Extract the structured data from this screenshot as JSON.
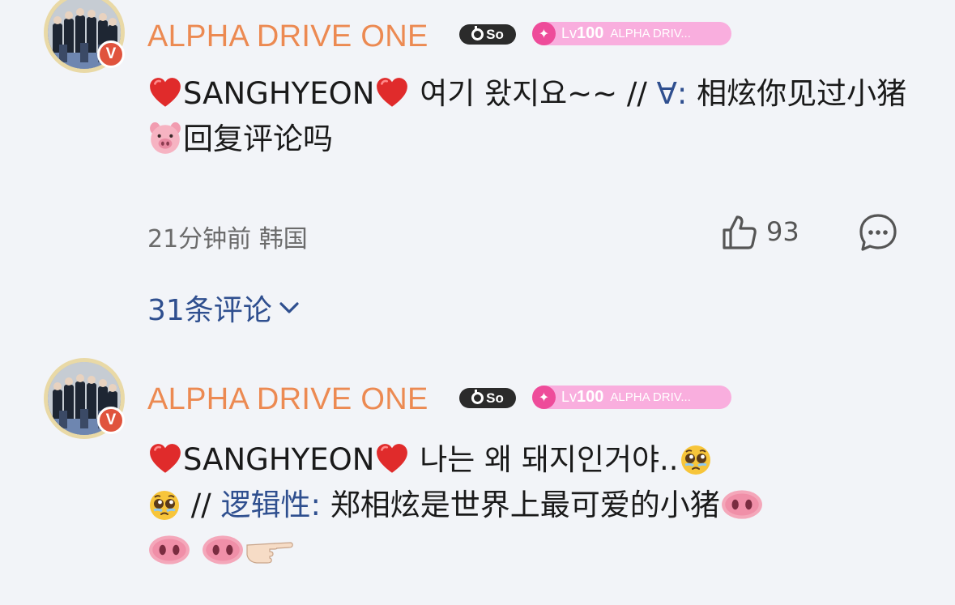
{
  "comments": [
    {
      "username": "ALPHA DRIVE ONE",
      "verified_badge": "V",
      "svip_label": "So",
      "level_prefix": "Lv",
      "level_number": "100",
      "level_name": "ALPHA DRIV...",
      "text_a": "SANGHYEON",
      "text_b": " 여기 왔지요~~ // ",
      "mention": "∀:",
      "text_c": " 相炫你见过小猪",
      "text_d": "回复评论吗",
      "time": "21分钟前",
      "location": "韩国",
      "likes": "93",
      "replies_label": "31条评论"
    },
    {
      "username": "ALPHA DRIVE ONE",
      "verified_badge": "V",
      "svip_label": "So",
      "level_prefix": "Lv",
      "level_number": "100",
      "level_name": "ALPHA DRIV...",
      "text_a": "SANGHYEON",
      "text_b": " 나는 왜 돼지인거야..",
      "text_c": " // ",
      "mention": "逻辑性:",
      "text_d": " 郑相炫是世界上最可爱的小猪"
    }
  ],
  "colors": {
    "background": "#f2f4f8",
    "username": "#ec8a52",
    "mention": "#2f4f8f",
    "level_badge": "#f9aede",
    "verified": "#e0533d"
  },
  "icons": [
    "red-heart-icon",
    "pig-face-icon",
    "pig-nose-icon",
    "pleading-face-icon",
    "pointing-hand-icon",
    "thumbs-up-icon",
    "comment-bubble-icon",
    "chevron-down-icon"
  ]
}
